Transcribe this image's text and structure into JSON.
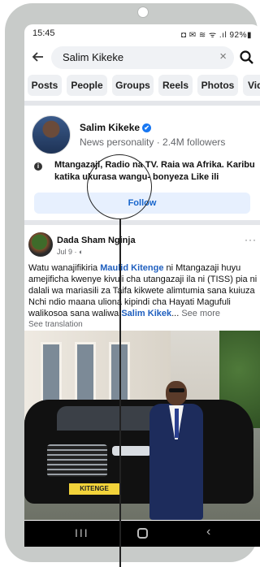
{
  "status_bar": {
    "time": "15:45",
    "icons": "◘ ✉ ≋ ᯤ .ıl 92%▮"
  },
  "search": {
    "back_icon": "arrow-left-icon",
    "query": "Salim Kikeke",
    "clear_icon": "×"
  },
  "filters": [
    "Posts",
    "People",
    "Groups",
    "Reels",
    "Photos",
    "Vid"
  ],
  "profile": {
    "name": "Salim Kikeke",
    "verified": "✔",
    "meta": "News personality · 2.4M followers",
    "info_icon": "i",
    "bio": "Mtangazaji, Radio na TV. Raia wa Afrika. Karibu katika ukurasa wangu- bonyeza Like ili",
    "follow_label": "Follow"
  },
  "post": {
    "author": "Dada Sham Nginja",
    "time": "Jul 9 · ◐",
    "more": "···",
    "text_before": "Watu wanajifikiria ",
    "mention_1": "Maulid Kitenge",
    "text_middle": " ni Mtangazaji  huyu amejificha kwenye kivuli cha utangazaji ila ni (TISS) pia ni dalali wa mariasili za Taifa  kikwete alimtumia sana kuiuza Nchi  ndio maana uliona kipindi cha  Hayati Magufuli  walikosoa sana waliwa ",
    "mention_2": "Salim Kikek",
    "text_after": "...",
    "see_more": " See more",
    "see_translation": "See translation",
    "plate": "KITENGE"
  },
  "nav_bar": {
    "recents": "III",
    "back": "‹"
  },
  "colors": {
    "accent": "#1877f2",
    "follow_bg": "#e7f0fe",
    "follow_text": "#1765cc",
    "shell": "#c8cbc9"
  }
}
